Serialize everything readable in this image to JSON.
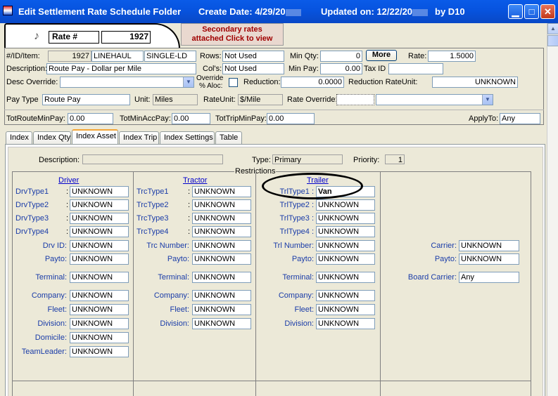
{
  "titlebar": {
    "title": "Edit Settlement Rate Schedule Folder",
    "create_label": "Create Date: 4/29/20",
    "updated_label": "Updated on: 12/22/20",
    "by_label": "by  D10"
  },
  "header": {
    "rate_label": "Rate #",
    "rate_value": "1927",
    "secondary_line1": "Secondary rates",
    "secondary_line2": "attached Click to view",
    "music_glyph": "♪"
  },
  "form": {
    "id_item_label": "#/ID/Item:",
    "id_value": "1927",
    "id_code": "LINEHAUL",
    "id_item": "SINGLE-LD",
    "rows_label": "Rows:",
    "rows_value": "Not Used",
    "min_qty_label": "Min Qty:",
    "min_qty_value": "0",
    "more_label": "More",
    "rate_label": "Rate:",
    "rate_value": "1.5000",
    "description_label": "Description:",
    "description_value": "Route Pay - Dollar per Mile",
    "cols_label": "Col's:",
    "cols_value": "Not Used",
    "min_pay_label": "Min Pay:",
    "min_pay_value": "0.00",
    "tax_id_label": "Tax ID",
    "tax_id_value": "",
    "desc_override_label": "Desc Override:",
    "desc_override_value": "",
    "override_label1": "Override",
    "override_label2": "% Aloc:",
    "reduction_label": "Reduction:",
    "reduction_value": "0.0000",
    "reduction_rate_unit_label": "Reduction RateUnit:",
    "reduction_rate_unit_value": "UNKNOWN",
    "pay_type_label": "Pay Type",
    "pay_type_value": "Route Pay",
    "unit_label": "Unit:",
    "unit_value": "Miles",
    "rate_unit_label": "RateUnit:",
    "rate_unit_value": "$/Mile",
    "rate_override_label": "Rate Override:",
    "rate_override_value": "",
    "tot_route_label": "TotRouteMinPay:",
    "tot_route_value": "0.00",
    "tot_min_acc_label": "TotMinAccPay:",
    "tot_min_acc_value": "0.00",
    "tot_trip_label": "TotTripMinPay:",
    "tot_trip_value": "0.00",
    "apply_to_label": "ApplyTo:",
    "apply_to_value": "Any"
  },
  "tabs": [
    "Index",
    "Index Qty",
    "Index Asset",
    "Index Trip",
    "Index Settings",
    "Table"
  ],
  "asset": {
    "description_label": "Description:",
    "description_value": "",
    "type_label": "Type:",
    "type_value": "Primary",
    "priority_label": "Priority:",
    "priority_value": "1",
    "restrictions_label": "Restrictions"
  },
  "driver": {
    "heading": "Driver",
    "rows": [
      {
        "label": "DrvType1",
        "sep": ":",
        "value": "UNKNOWN"
      },
      {
        "label": "DrvType2",
        "sep": ":",
        "value": "UNKNOWN"
      },
      {
        "label": "DrvType3",
        "sep": ":",
        "value": "UNKNOWN"
      },
      {
        "label": "DrvType4",
        "sep": ":",
        "value": "UNKNOWN"
      },
      {
        "label": "Drv ID:",
        "sep": "",
        "value": "UNKNOWN"
      },
      {
        "label": "Payto:",
        "sep": "",
        "value": "UNKNOWN"
      },
      {
        "label": "Terminal:",
        "sep": "",
        "value": "UNKNOWN"
      },
      {
        "label": "Company:",
        "sep": "",
        "value": "UNKNOWN"
      },
      {
        "label": "Fleet:",
        "sep": "",
        "value": "UNKNOWN"
      },
      {
        "label": "Division:",
        "sep": "",
        "value": "UNKNOWN"
      },
      {
        "label": "Domicile:",
        "sep": "",
        "value": "UNKNOWN"
      },
      {
        "label": "TeamLeader:",
        "sep": "",
        "value": "UNKNOWN"
      }
    ]
  },
  "tractor": {
    "heading": "Tractor",
    "rows": [
      {
        "label": "TrcType1",
        "sep": ":",
        "value": "UNKNOWN"
      },
      {
        "label": "TrcType2",
        "sep": ":",
        "value": "UNKNOWN"
      },
      {
        "label": "TrcType3",
        "sep": ":",
        "value": "UNKNOWN"
      },
      {
        "label": "TrcType4",
        "sep": ":",
        "value": "UNKNOWN"
      },
      {
        "label": "Trc Number:",
        "sep": "",
        "value": "UNKNOWN"
      },
      {
        "label": "Payto:",
        "sep": "",
        "value": "UNKNOWN"
      },
      {
        "label": "Terminal:",
        "sep": "",
        "value": "UNKNOWN"
      },
      {
        "label": "Company:",
        "sep": "",
        "value": "UNKNOWN"
      },
      {
        "label": "Fleet:",
        "sep": "",
        "value": "UNKNOWN"
      },
      {
        "label": "Division:",
        "sep": "",
        "value": "UNKNOWN"
      }
    ]
  },
  "trailer": {
    "heading": "Trailer",
    "rows": [
      {
        "label": "TrlType1 :",
        "sep": "",
        "value": "Van"
      },
      {
        "label": "TrlType2 :",
        "sep": "",
        "value": "UNKNOWN"
      },
      {
        "label": "TrlType3 :",
        "sep": "",
        "value": "UNKNOWN"
      },
      {
        "label": "TrlType4 :",
        "sep": "",
        "value": "UNKNOWN"
      },
      {
        "label": "Trl Number:",
        "sep": "",
        "value": "UNKNOWN"
      },
      {
        "label": "Payto:",
        "sep": "",
        "value": "UNKNOWN"
      },
      {
        "label": "Terminal:",
        "sep": "",
        "value": "UNKNOWN"
      },
      {
        "label": "Company:",
        "sep": "",
        "value": "UNKNOWN"
      },
      {
        "label": "Fleet:",
        "sep": "",
        "value": "UNKNOWN"
      },
      {
        "label": "Division:",
        "sep": "",
        "value": "UNKNOWN"
      }
    ]
  },
  "carrier": {
    "rows": [
      {
        "label": "Carrier:",
        "value": "UNKNOWN"
      },
      {
        "label": "Payto:",
        "value": "UNKNOWN"
      },
      {
        "label": "Board Carrier:",
        "value": "Any"
      }
    ]
  }
}
